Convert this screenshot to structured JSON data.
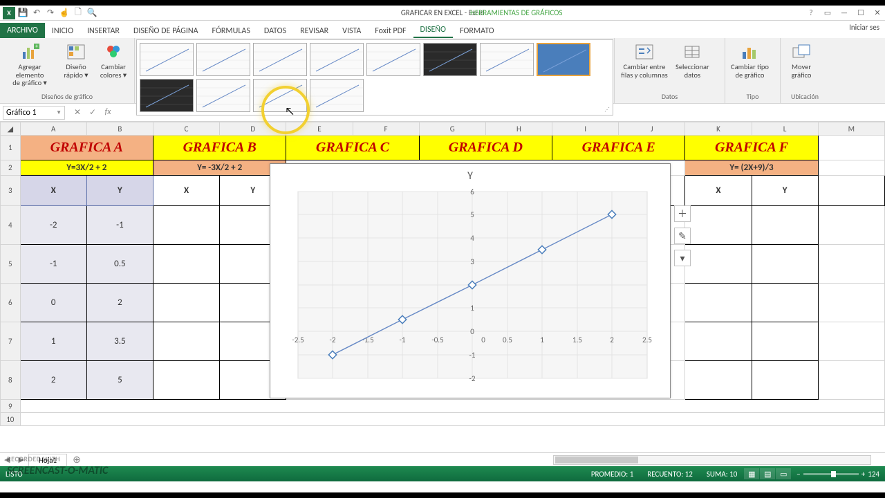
{
  "title": {
    "filename": "GRAFICAR EN EXCEL",
    "app": "Excel",
    "tools": "HERRAMIENTAS DE GRÁFICOS",
    "signin": "Iniciar ses"
  },
  "tabs": {
    "file": "ARCHIVO",
    "inicio": "INICIO",
    "insertar": "INSERTAR",
    "diseno_pagina": "DISEÑO DE PÁGINA",
    "formulas": "FÓRMULAS",
    "datos": "DATOS",
    "revisar": "REVISAR",
    "vista": "VISTA",
    "foxit": "Foxit PDF",
    "diseno": "DISEÑO",
    "formato": "FORMATO"
  },
  "ribbon": {
    "group_disenos": "Diseños de gráfico",
    "agregar": "Agregar elemento\nde gráfico ▾",
    "dis_rapido": "Diseño\nrápido ▾",
    "cambiar_colores": "Cambiar\ncolores ▾",
    "group_datos": "Datos",
    "cambiar_filas": "Cambiar entre\nfilas y columnas",
    "seleccionar": "Seleccionar\ndatos",
    "group_tipo": "Tipo",
    "cambiar_tipo": "Cambiar tipo\nde gráfico",
    "group_ubic": "Ubicación",
    "mover": "Mover\ngráfico"
  },
  "namebox": "Gráfico 1",
  "columns": [
    "A",
    "B",
    "C",
    "D",
    "E",
    "F",
    "G",
    "H",
    "I",
    "J",
    "K",
    "L",
    "M"
  ],
  "rows": [
    "1",
    "2",
    "3",
    "4",
    "5",
    "6",
    "7",
    "8",
    "9",
    "10"
  ],
  "headers": {
    "a": "GRAFICA A",
    "b": "GRAFICA B",
    "c": "GRAFICA C",
    "d": "GRAFICA D",
    "e": "GRAFICA E",
    "f": "GRAFICA F"
  },
  "formulas": {
    "a": "Y=3X/2 + 2",
    "b": "Y= -3X/2  + 2",
    "f": "Y= (2X+9)/3"
  },
  "xy": {
    "x": "X",
    "y": "Y"
  },
  "tableA": {
    "x": [
      "-2",
      "-1",
      "0",
      "1",
      "2"
    ],
    "y": [
      "-1",
      "0.5",
      "2",
      "3.5",
      "5"
    ]
  },
  "chart": {
    "title": "Y"
  },
  "chart_data": {
    "type": "scatter",
    "title": "Y",
    "xlabel": "",
    "ylabel": "",
    "xlim": [
      -2.5,
      2.5
    ],
    "ylim": [
      -2,
      6
    ],
    "xticks": [
      -2.5,
      -2,
      -1.5,
      -1,
      -0.5,
      0,
      0.5,
      1,
      1.5,
      2,
      2.5
    ],
    "yticks": [
      -2,
      -1,
      0,
      1,
      2,
      3,
      4,
      5,
      6
    ],
    "series": [
      {
        "name": "Y",
        "x": [
          -2,
          -1,
          0,
          1,
          2
        ],
        "y": [
          -1,
          0.5,
          2,
          3.5,
          5
        ]
      }
    ]
  },
  "side": {
    "plus": "＋",
    "brush": "✎",
    "filter": "▾"
  },
  "status": {
    "listo": "LISTO",
    "promedio": "PROMEDIO: 1",
    "recuento": "RECUENTO: 12",
    "suma": "SUMA: 10",
    "zoom": "124"
  },
  "sheet": {
    "name": "Hoja1"
  },
  "watermark1": "RECORDED WITH",
  "watermark2": "SCREENCAST-O-MATIC"
}
